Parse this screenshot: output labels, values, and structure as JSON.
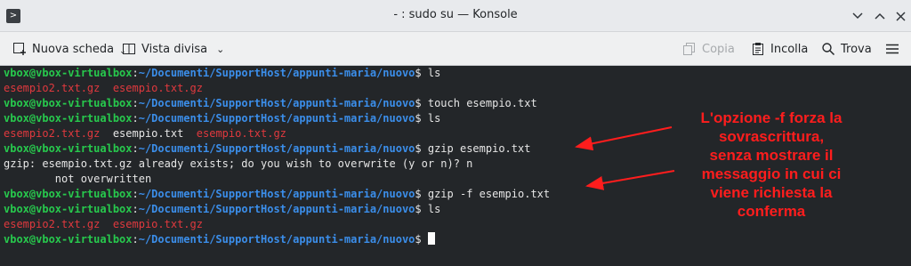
{
  "window": {
    "title": "- : sudo su — Konsole"
  },
  "toolbar": {
    "new_tab": "Nuova scheda",
    "split_view": "Vista divisa",
    "copy": "Copia",
    "paste": "Incolla",
    "find": "Trova"
  },
  "terminal": {
    "prompt_user": "vbox@vbox-virtualbox",
    "prompt_path": "~/Documenti/SupportHost/appunti-maria/nuovo",
    "lines": [
      {
        "cmd": "ls"
      },
      {
        "out_red1": "esempio2.txt.gz",
        "out_red2": "esempio.txt.gz"
      },
      {
        "cmd": "touch esempio.txt"
      },
      {
        "cmd": "ls"
      },
      {
        "out_red1": "esempio2.txt.gz",
        "out_white": "esempio.txt",
        "out_red2": "esempio.txt.gz"
      },
      {
        "cmd": "gzip esempio.txt"
      },
      {
        "out": "gzip: esempio.txt.gz already exists; do you wish to overwrite (y or n)? n"
      },
      {
        "out": "        not overwritten"
      },
      {
        "cmd": "gzip -f esempio.txt"
      },
      {
        "cmd": "ls"
      },
      {
        "out_red1": "esempio2.txt.gz",
        "out_red2": "esempio.txt.gz"
      },
      {
        "cmd": ""
      }
    ]
  },
  "annotation": {
    "lines": [
      "L'opzione -f forza la",
      "sovrascrittura,",
      "senza mostrare il",
      "messaggio in cui ci",
      "viene richiesta la",
      "conferma"
    ],
    "color": "#ff1d1d"
  },
  "colors": {
    "user": "#27c94d",
    "path": "#3b8eea",
    "error_file": "#e0393e",
    "background": "#232629"
  }
}
